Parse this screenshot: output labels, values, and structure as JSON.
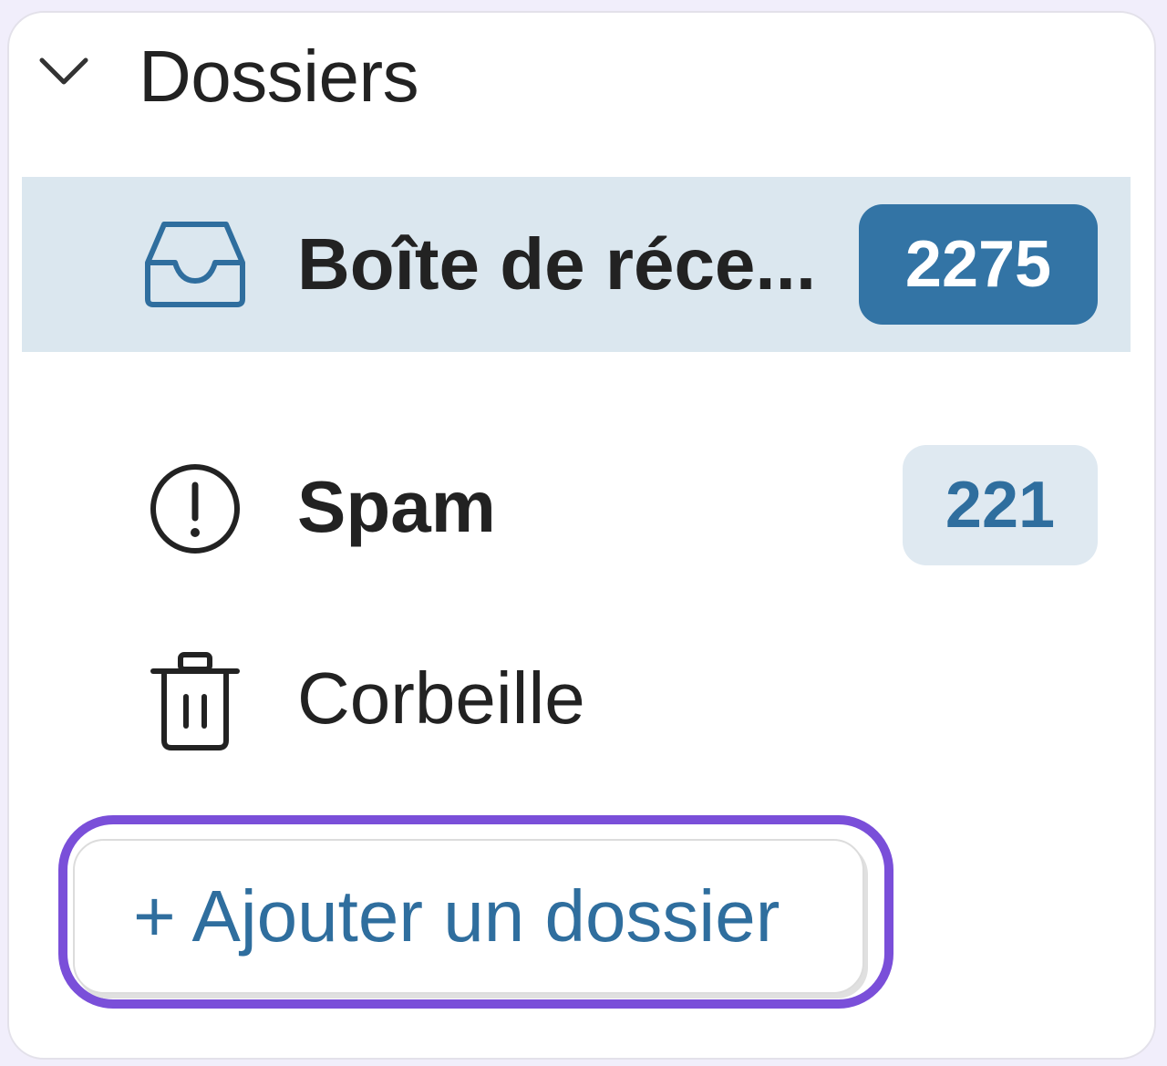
{
  "folders_section": {
    "title": "Dossiers",
    "toggle_icon": "chevron-down-icon",
    "items": [
      {
        "label": "Boîte de réce...",
        "icon": "inbox-tray-icon",
        "count": "2275",
        "selected": true,
        "badge_style": "primary"
      },
      {
        "label": "Spam",
        "icon": "exclamation-circle-icon",
        "count": "221",
        "selected": false,
        "badge_style": "soft"
      },
      {
        "label": "Corbeille",
        "icon": "trash-icon",
        "count": null,
        "selected": false
      }
    ],
    "add_button_label": "+ Ajouter un dossier"
  },
  "colors": {
    "accent": "#3374a5",
    "selected_row": "#dbe7ef",
    "highlight_outline": "#7a4fd9"
  }
}
